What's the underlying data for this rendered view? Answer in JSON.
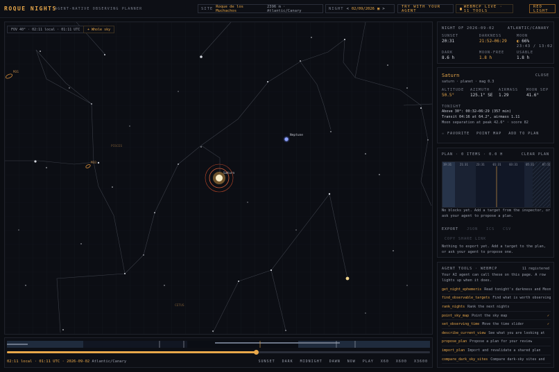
{
  "header": {
    "brand": "ROQUE NIGHTS",
    "tagline": "AGENT-NATIVE OBSERVING PLANNER",
    "site_label": "SITE",
    "site_name": "Roque de los Muchachos",
    "site_detail": "2396 m · Atlantic/Canary",
    "night_label": "NIGHT",
    "night_prev": "<",
    "night_date": "02/09/2026",
    "night_next": ">",
    "try_agent": "TRY WITH YOUR AGENT",
    "webmcp": "WEBMCP LIVE · 11 TOOLS",
    "red_light": "RED LIGHT"
  },
  "sky": {
    "fov": "FOV 40° · 02:11 local · 01:11 UTC",
    "whole_sky": "+ Whole sky",
    "labels": {
      "saturn": "Saturn",
      "neptune": "Neptune",
      "pisces": "PISCES",
      "cetus": "CETUS",
      "m31": "M31",
      "m33": "M33"
    }
  },
  "timeline": {
    "progress": 0.59,
    "time_text": "02:11 local · 01:11 UTC · 2026-09-02",
    "tz": "Atlantic/Canary",
    "buttons": [
      "SUNSET",
      "DARK",
      "MIDNIGHT",
      "DAWN",
      "NOW",
      "PLAY",
      "X60",
      "X600",
      "X3600"
    ]
  },
  "night_panel": {
    "title": "NIGHT OF 2026-09-02",
    "tz": "ATLANTIC/CANARY",
    "sunset_label": "SUNSET",
    "sunset": "20:31",
    "darkness_label": "DARKNESS",
    "darkness": "21:52–06:29",
    "moon_label": "MOON",
    "moon": "66%",
    "moon_times": "23:43 / 13:02",
    "dark_label": "DARK",
    "dark": "8.6 h",
    "moonfree_label": "MOON-FREE",
    "moonfree": "1.8 h",
    "usable_label": "USABLE",
    "usable": "1.8 h"
  },
  "target_panel": {
    "name": "Saturn",
    "sub": "saturn · planet · mag 0.3",
    "close": "CLOSE",
    "altitude_label": "ALTITUDE",
    "altitude": "50.5°",
    "azimuth_label": "AZIMUTH",
    "azimuth": "125.1° SE",
    "airmass_label": "AIRMASS",
    "airmass": "1.29",
    "moonsep_label": "MOON SEP",
    "moonsep": "41.6°",
    "tonight_label": "TONIGHT",
    "tonight_1": "Above 30°: 00:32–06:29 (357 min)",
    "tonight_2": "Transit 04:16 at 64.2°, airmass 1.11",
    "tonight_3": "Moon separation at peak 42.6° · score 82",
    "favorite": "☆ FAVORITE",
    "point_map": "POINT MAP",
    "add_plan": "ADD TO PLAN"
  },
  "plan_panel": {
    "title": "PLAN · 0 ITEMS · 0.0 H",
    "clear": "CLEAR PLAN",
    "hours": [
      "19:31",
      "21:31",
      "23:31",
      "01:31",
      "03:31",
      "05:31",
      "07:31"
    ],
    "empty": "No blocks yet. Add a target from the inspector, or ask your agent to propose a plan.",
    "export_label": "EXPORT",
    "json": "JSON",
    "ics": "ICS",
    "csv": "CSV",
    "share": "COPY SHARE LINK",
    "export_empty": "Nothing to export yet. Add a target to the plan, or ask your agent to propose one."
  },
  "tools_panel": {
    "title": "AGENT TOOLS · WEBMCP",
    "registered": "11 registered",
    "desc": "Your AI agent can call these on this page. A row lights up when it does.",
    "tools": [
      {
        "name": "get_night_ephemeris",
        "desc": "Read tonight's darkness and Moon",
        "check": ""
      },
      {
        "name": "find_observable_targets",
        "desc": "Find what is worth observing",
        "check": ""
      },
      {
        "name": "rank_nights",
        "desc": "Rank the next nights",
        "check": ""
      },
      {
        "name": "point_sky_map",
        "desc": "Point the sky map",
        "check": "✓"
      },
      {
        "name": "set_observing_time",
        "desc": "Move the time slider",
        "check": "✓"
      },
      {
        "name": "describe_current_view",
        "desc": "See what you are looking at",
        "check": ""
      },
      {
        "name": "propose_plan",
        "desc": "Propose a plan for your review",
        "check": ""
      },
      {
        "name": "import_plan",
        "desc": "Import and revalidate a shared plan",
        "check": ""
      },
      {
        "name": "compare_dark_sky_sites",
        "desc": "Compare dark-sky sites and",
        "check": ""
      }
    ]
  }
}
